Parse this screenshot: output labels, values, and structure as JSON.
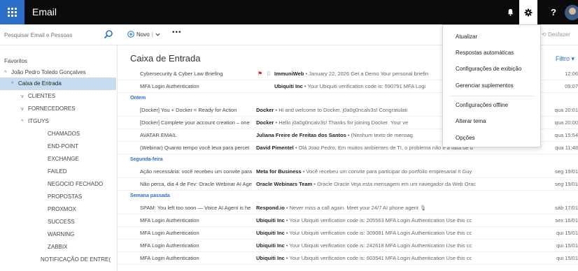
{
  "header": {
    "app_title": "Email",
    "help_label": "?"
  },
  "search": {
    "placeholder": "Pesquisar Email e Pessoas"
  },
  "toolbar": {
    "new_label": "Novo",
    "more_label": "•••",
    "undo_label": "Desfazer"
  },
  "sidebar": {
    "items": [
      {
        "label": "Favoritos",
        "chev": ""
      },
      {
        "label": "João Pedro Toledo Gonçalves",
        "chev": "^"
      },
      {
        "label": "Caixa de Entrada",
        "chev": "^"
      },
      {
        "label": "CLIENTES",
        "chev": "v"
      },
      {
        "label": "FORNECEDORES",
        "chev": "v"
      },
      {
        "label": "ITGUYS",
        "chev": "^"
      },
      {
        "label": "CHAMADOS",
        "chev": ""
      },
      {
        "label": "END-POINT",
        "chev": ""
      },
      {
        "label": "EXCHANGE",
        "chev": ""
      },
      {
        "label": "FAILED",
        "chev": ""
      },
      {
        "label": "NEGOCIO FECHADO",
        "chev": ""
      },
      {
        "label": "PROPOSTAS",
        "chev": ""
      },
      {
        "label": "PROXMOX",
        "chev": ""
      },
      {
        "label": "SUCCESS",
        "chev": ""
      },
      {
        "label": "WARNING",
        "chev": ""
      },
      {
        "label": "ZABBIX",
        "chev": ""
      },
      {
        "label": "NOTIFICAÇÃO DE ENTRE(",
        "chev": ""
      }
    ]
  },
  "main": {
    "title": "Caixa de Entrada",
    "filter_label": "Filtro ▾",
    "groups": [
      "Ontem",
      "Segunda-feira",
      "Semana passada"
    ],
    "rows": [
      {
        "subject": "Cybersecurity & Cyber Law Briefing",
        "sender": "ImmuniWeb",
        "preview": " • January 22, 2026 Get a Demo Your personal briefin",
        "date": "12:06"
      },
      {
        "subject": "MFA Login Authentication",
        "sender": "Ubiquiti Inc",
        "preview": " • Your Ubiquiti verification code is: 590791 MFA Logi",
        "date": "09:07"
      },
      {
        "subject": "[Docker] You + Docker = Ready for Action",
        "sender": "Docker",
        "preview": " • Hi and welcome to Docker, j0a0g0ncalv3s! Congratulati",
        "date": "qua 20:01"
      },
      {
        "subject": "[Docker] Complete your account creation – one",
        "sender": "Docker",
        "preview": " • Hello j0a0g0ncalv3s! Thanks for joining Docker. Your ve",
        "date": "qua 20:00"
      },
      {
        "subject": "AVATAR EMAIL",
        "sender": "Juliana Freire de Freitas dos Santos",
        "preview": " • (Nenhum texto de mensag",
        "date": "qua 15:54"
      },
      {
        "subject": "(Webinar) Quanto tempo você leva para percet",
        "sender": "David Pimentel",
        "preview": " • Olá Joao Pedro, Em muitos ambientes de TI, o problema não é a falta de d",
        "date": "qua 11:48"
      },
      {
        "subject": "Ação necessária: você recebeu um convite para",
        "sender": "Meta for Business",
        "preview": " • Você recebeu um convite para participar do portfólio empresarial It Guy",
        "date": "seg 19/01"
      },
      {
        "subject": "Não perca, dia 4 de Fev: Oracle Webinar AI Age",
        "sender": "Oracle Webinars Team",
        "preview": " • Oracle Oracle Veja esta mensagem em um navegador da Web Orac",
        "date": "seg 19/01"
      },
      {
        "subject": "SPAM: You left too soon — Voice AI Agent is he",
        "sender": "Respond.io",
        "preview": " • Never miss a call again. Meet your 24/7 AI phone agent 🎙",
        "date": "sáb 17/01"
      },
      {
        "subject": "MFA Login Authentication",
        "sender": "Ubiquiti Inc",
        "preview": " • Your Ubiquiti verification code is: 205563 MFA Login Authentication Use this cc",
        "date": "sex 16/01"
      },
      {
        "subject": "MFA Login Authentication",
        "sender": "Ubiquiti Inc",
        "preview": " • Your Ubiquiti verification code is: 309081 MFA Login Authentication Use this cc",
        "date": "qui 15/01"
      },
      {
        "subject": "MFA Login Authentication",
        "sender": "Ubiquiti Inc",
        "preview": " • Your Ubiquiti verification code is: 242618 MFA Login Authentication Use this cc",
        "date": "qui 15/01"
      },
      {
        "subject": "MFA Login Authentication",
        "sender": "Ubiquiti Inc",
        "preview": " • Your Ubiquiti verification code is: 603541 MFA Login Authentication Use this cc",
        "date": "qui 15/01"
      }
    ]
  },
  "settings_menu": {
    "items": [
      "Atualizar",
      "Respostas automáticas",
      "Configurações de exibição",
      "Gerenciar suplementos",
      "Configurações offline",
      "Alterar tema",
      "Opções"
    ]
  },
  "colors": {
    "topbar": "#0b0b0b",
    "waffle": "#2a6fc9",
    "accent": "#2a6fc9",
    "selected_folder": "#c7dcf1",
    "flag": "#c4262e"
  }
}
